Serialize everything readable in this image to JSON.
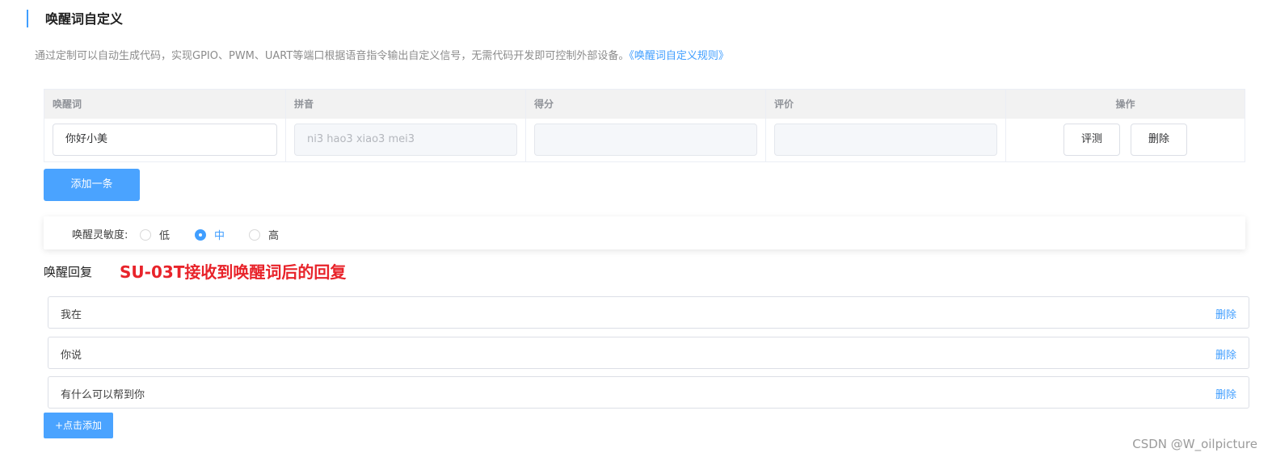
{
  "section": {
    "title": "唤醒词自定义",
    "description": "通过定制可以自动生成代码，实现GPIO、PWM、UART等端口根据语音指令输出自定义信号，无需代码开发即可控制外部设备。",
    "rules_link": "《唤醒词自定义规则》"
  },
  "table": {
    "headers": {
      "wake_word": "唤醒词",
      "pinyin": "拼音",
      "score": "得分",
      "evaluation": "评价",
      "actions": "操作"
    },
    "row": {
      "wake_word": "你好小美",
      "pinyin": "ni3 hao3 xiao3 mei3",
      "score": "",
      "evaluation": "",
      "evaluate_label": "评测",
      "delete_label": "删除"
    }
  },
  "add_row_label": "添加一条",
  "sensitivity": {
    "label": "唤醒灵敏度:",
    "options": [
      "低",
      "中",
      "高"
    ],
    "selected": "中"
  },
  "reply": {
    "title": "唤醒回复",
    "annotation": "SU-03T接收到唤醒词后的回复",
    "items": [
      {
        "text": "我在",
        "delete_label": "删除"
      },
      {
        "text": "你说",
        "delete_label": "删除"
      },
      {
        "text": "有什么可以帮到你",
        "delete_label": "删除"
      }
    ],
    "add_label": "+点击添加"
  },
  "watermark": "CSDN @W_oilpicture",
  "colors": {
    "accent": "#409eff",
    "primary_button": "#4aa3ff",
    "annotation": "#e8232a"
  }
}
